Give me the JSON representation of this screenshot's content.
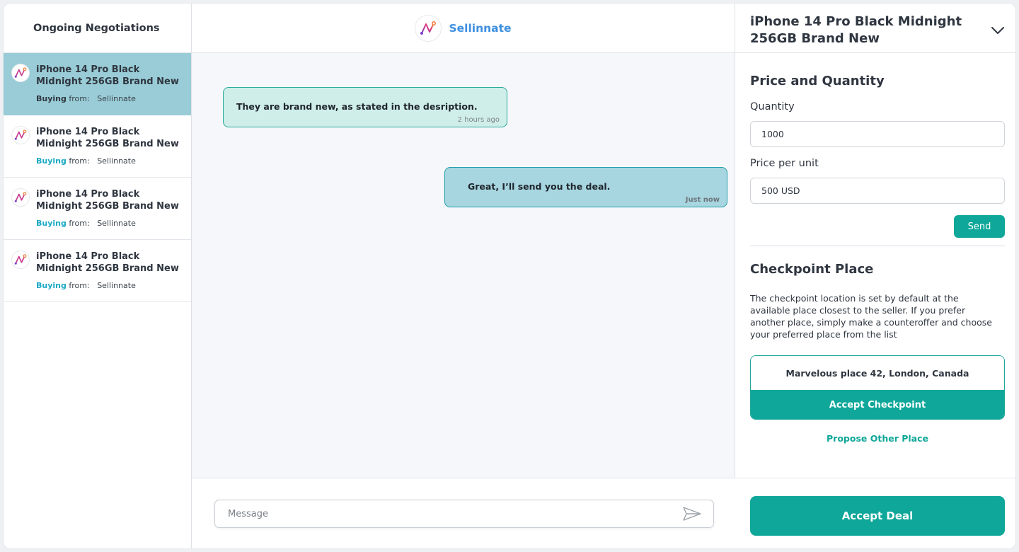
{
  "sidebar": {
    "title": "Ongoing Negotiations",
    "items": [
      {
        "title": "iPhone 14 Pro Black Midnight 256GB Brand New",
        "buying": "Buying",
        "from": "from:",
        "seller": "Sellinnate",
        "active": true
      },
      {
        "title": "iPhone 14 Pro Black Midnight 256GB Brand New",
        "buying": "Buying",
        "from": "from:",
        "seller": "Sellinnate",
        "active": false
      },
      {
        "title": "iPhone 14 Pro Black Midnight 256GB Brand New",
        "buying": "Buying",
        "from": "from:",
        "seller": "Sellinnate",
        "active": false
      },
      {
        "title": "iPhone 14 Pro Black Midnight 256GB Brand New",
        "buying": "Buying",
        "from": "from:",
        "seller": "Sellinnate",
        "active": false
      }
    ]
  },
  "chat": {
    "brand_name": "Sellinnate",
    "messages": [
      {
        "text": "They are brand new, as stated in the desription.",
        "time": "2 hours ago",
        "direction": "incoming"
      },
      {
        "text": "Great, I’ll send you the deal.",
        "time": "Just now",
        "direction": "outgoing"
      }
    ],
    "composer": {
      "placeholder": "Message",
      "value": ""
    }
  },
  "panel": {
    "product_title": "iPhone 14 Pro Black Midnight 256GB Brand New",
    "price_section": {
      "title": "Price and Quantity",
      "quantity_label": "Quantity",
      "quantity_value": "1000",
      "price_label": "Price per unit",
      "price_value": "500 USD",
      "send_label": "Send"
    },
    "checkpoint": {
      "title": "Checkpoint Place",
      "description": "The checkpoint location is set by default at the available place closest to the seller. If you prefer another place, simply make a counteroffer and choose your preferred place from the list",
      "place": "Marvelous place 42, London, Canada",
      "accept_label": "Accept Checkpoint",
      "propose_label": "Propose Other Place"
    },
    "accept_deal_label": "Accept Deal"
  },
  "colors": {
    "accent": "#0fa799",
    "active_item_bg": "#99ccd6",
    "brand_blue": "#3d8fe0",
    "buying_label": "#19a9c4"
  },
  "icons": {
    "logo": "sellinnate-logo-icon",
    "chevron": "chevron-down-icon",
    "send": "send-arrow-icon"
  }
}
